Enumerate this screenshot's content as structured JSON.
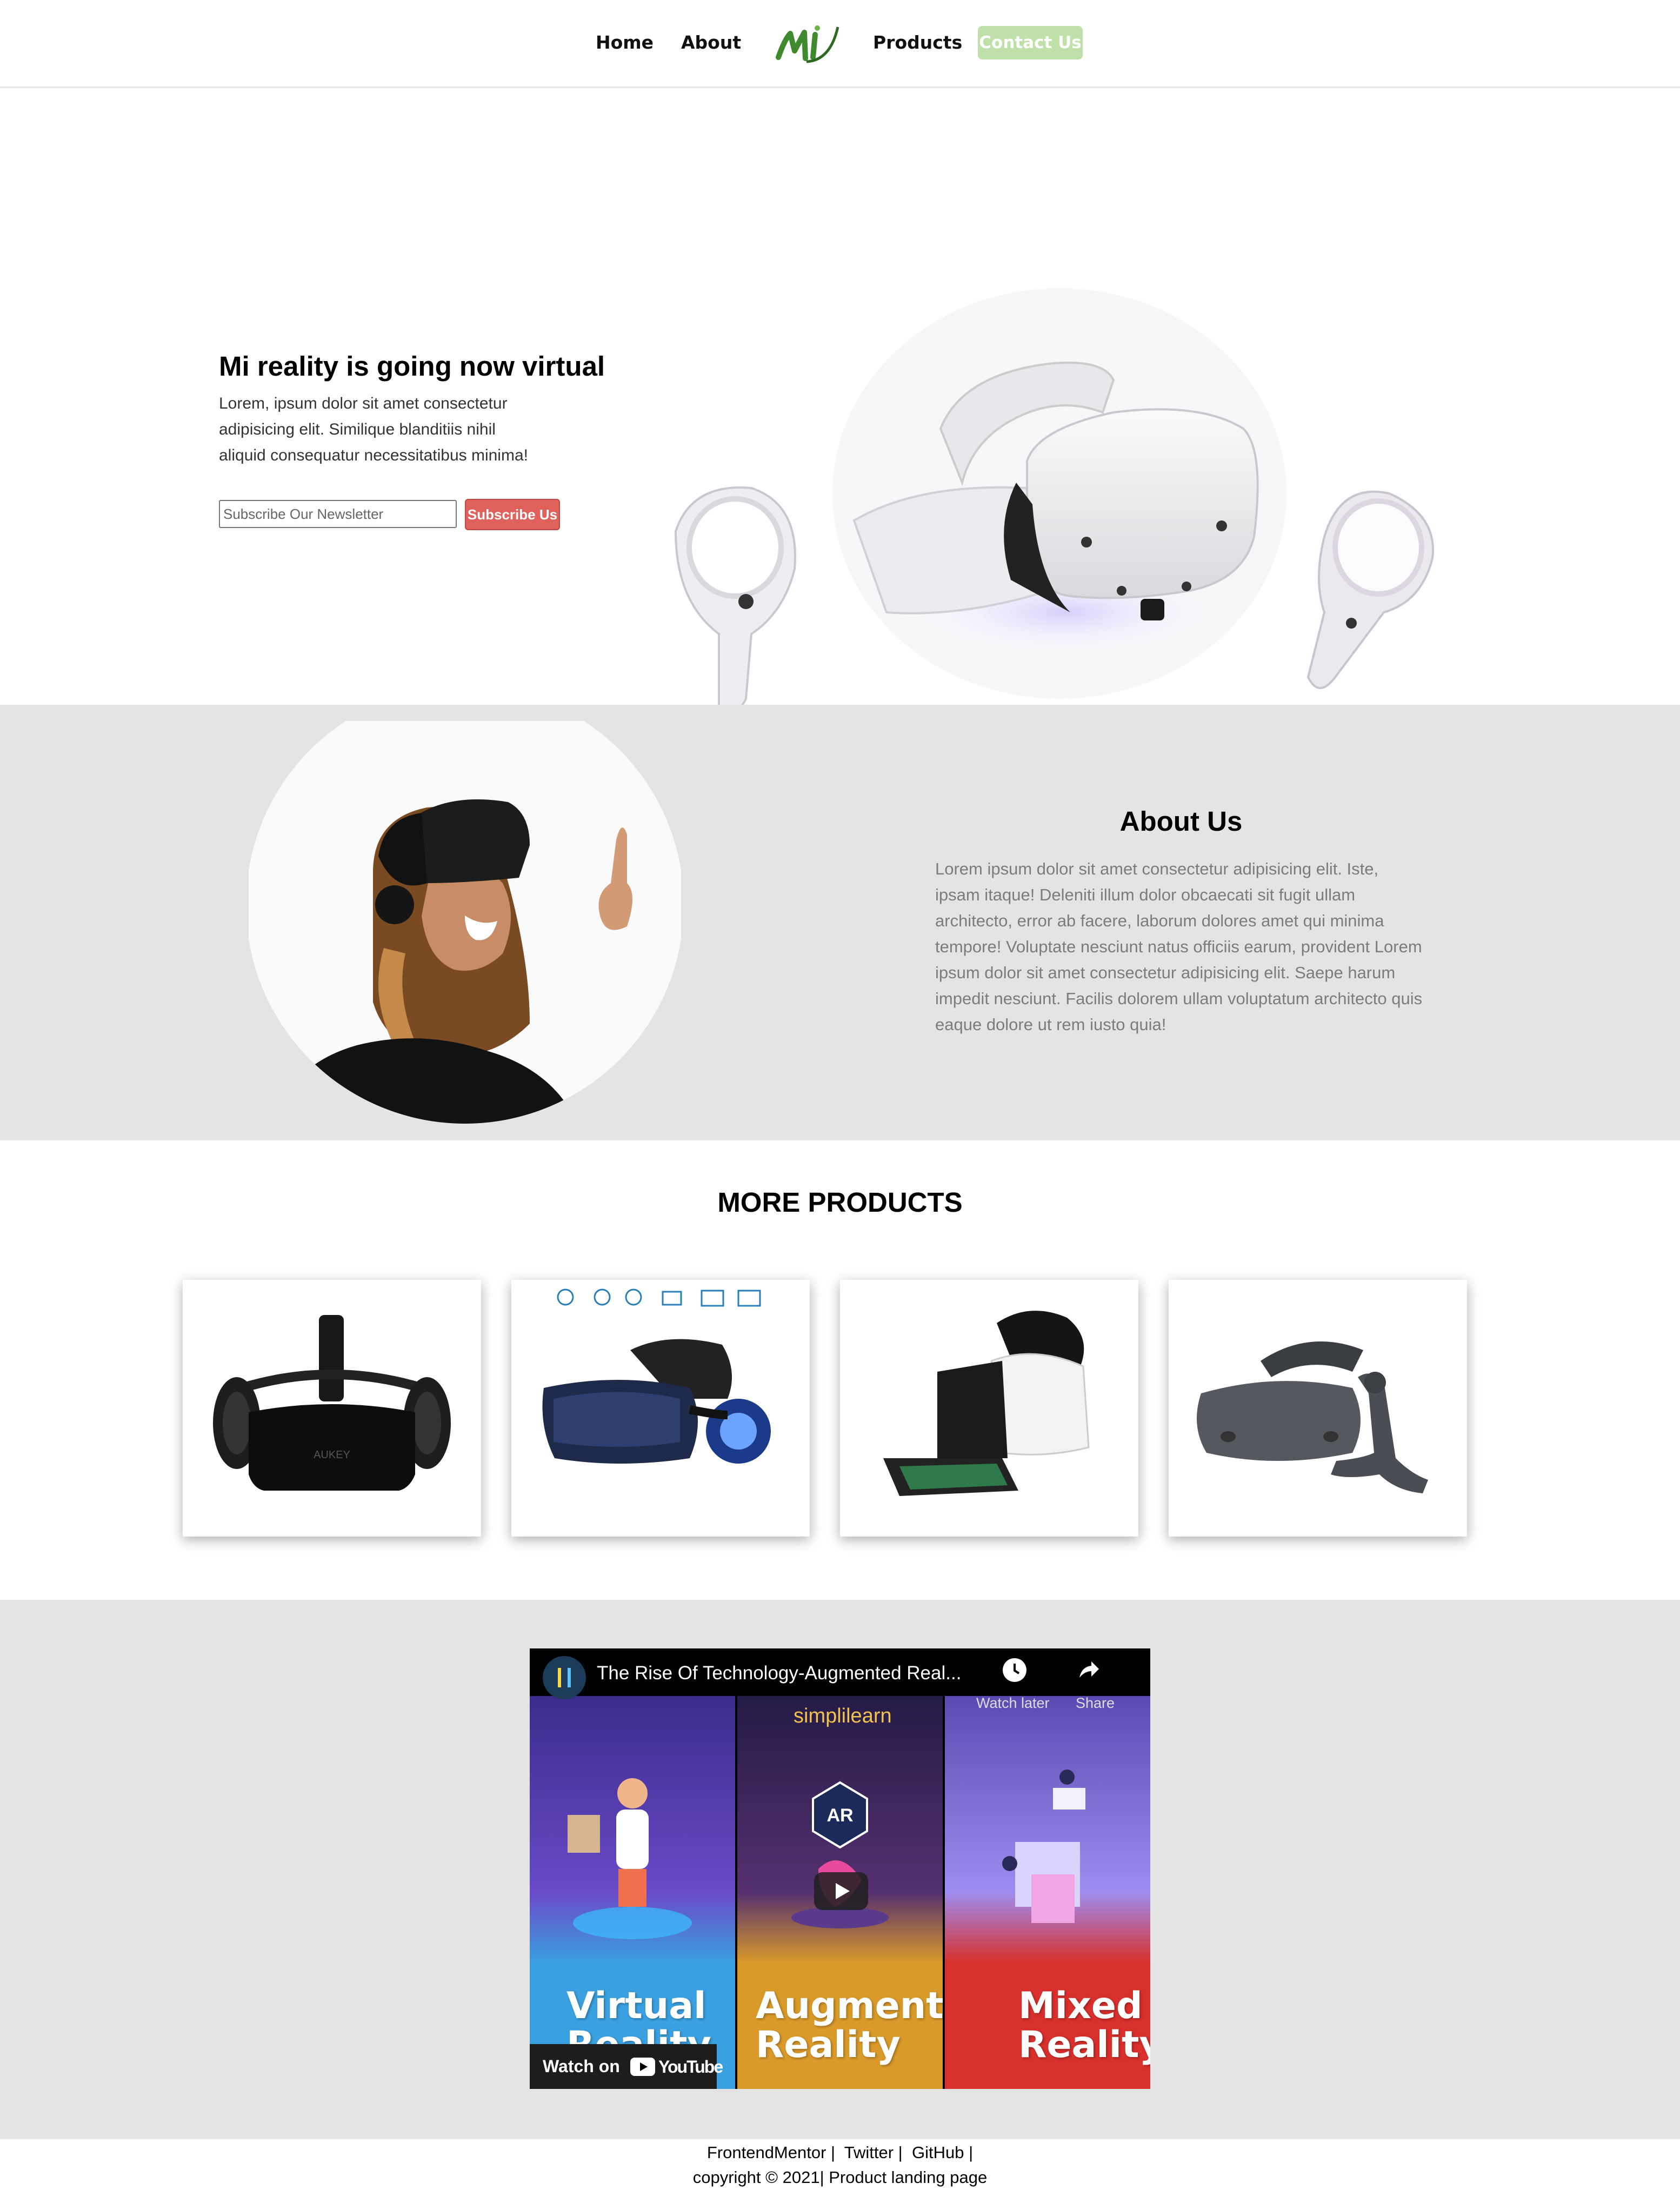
{
  "nav": {
    "home": "Home",
    "about": "About",
    "logo": "MI",
    "products": "Products",
    "contact": "Contact Us"
  },
  "hero": {
    "title": "Mi reality is going now virtual",
    "text": "Lorem, ipsum dolor sit amet consectetur adipisicing elit. Similique blanditiis nihil aliquid consequatur necessitatibus minima!",
    "newsletter_placeholder": "Subscribe Our Newsletter",
    "subscribe_label": "Subscribe Us"
  },
  "about": {
    "title": "About Us",
    "text": "Lorem ipsum dolor sit amet consectetur adipisicing elit. Iste, ipsam itaque! Deleniti illum dolor obcaecati sit fugit ullam architecto, error ab facere, laborum dolores amet qui minima tempore! Voluptate nesciunt natus officiis earum, provident Lorem ipsum dolor sit amet consectetur adipisicing elit. Saepe harum impedit nesciunt. Facilis dolorem ullam voluptatum architecto quis eaque dolore ut rem iusto quia!"
  },
  "products": {
    "title": "MORE PRODUCTS",
    "card1_brand": "AUKEY"
  },
  "video": {
    "title": "The Rise Of Technology-Augmented Real...",
    "watch_later": "Watch later",
    "share": "Share",
    "brand": "simplilearn",
    "ar_badge": "AR",
    "vr_label_1": "Virtual",
    "vr_label_2": "Reality",
    "ar_label_1": "Augmented",
    "ar_label_2": "Reality",
    "mr_label_1": "Mixed",
    "mr_label_2": "Reality",
    "watch_on": "Watch on",
    "youtube": "YouTube"
  },
  "footer": {
    "link1": "FrontendMentor",
    "link2": "Twitter",
    "link3": "GitHub",
    "copyright": "copyright © 2021| Product landing page"
  },
  "colors": {
    "accent_green": "#bfe0a8",
    "subscribe_red": "#e0605c",
    "section_grey": "#e4e4e4"
  }
}
